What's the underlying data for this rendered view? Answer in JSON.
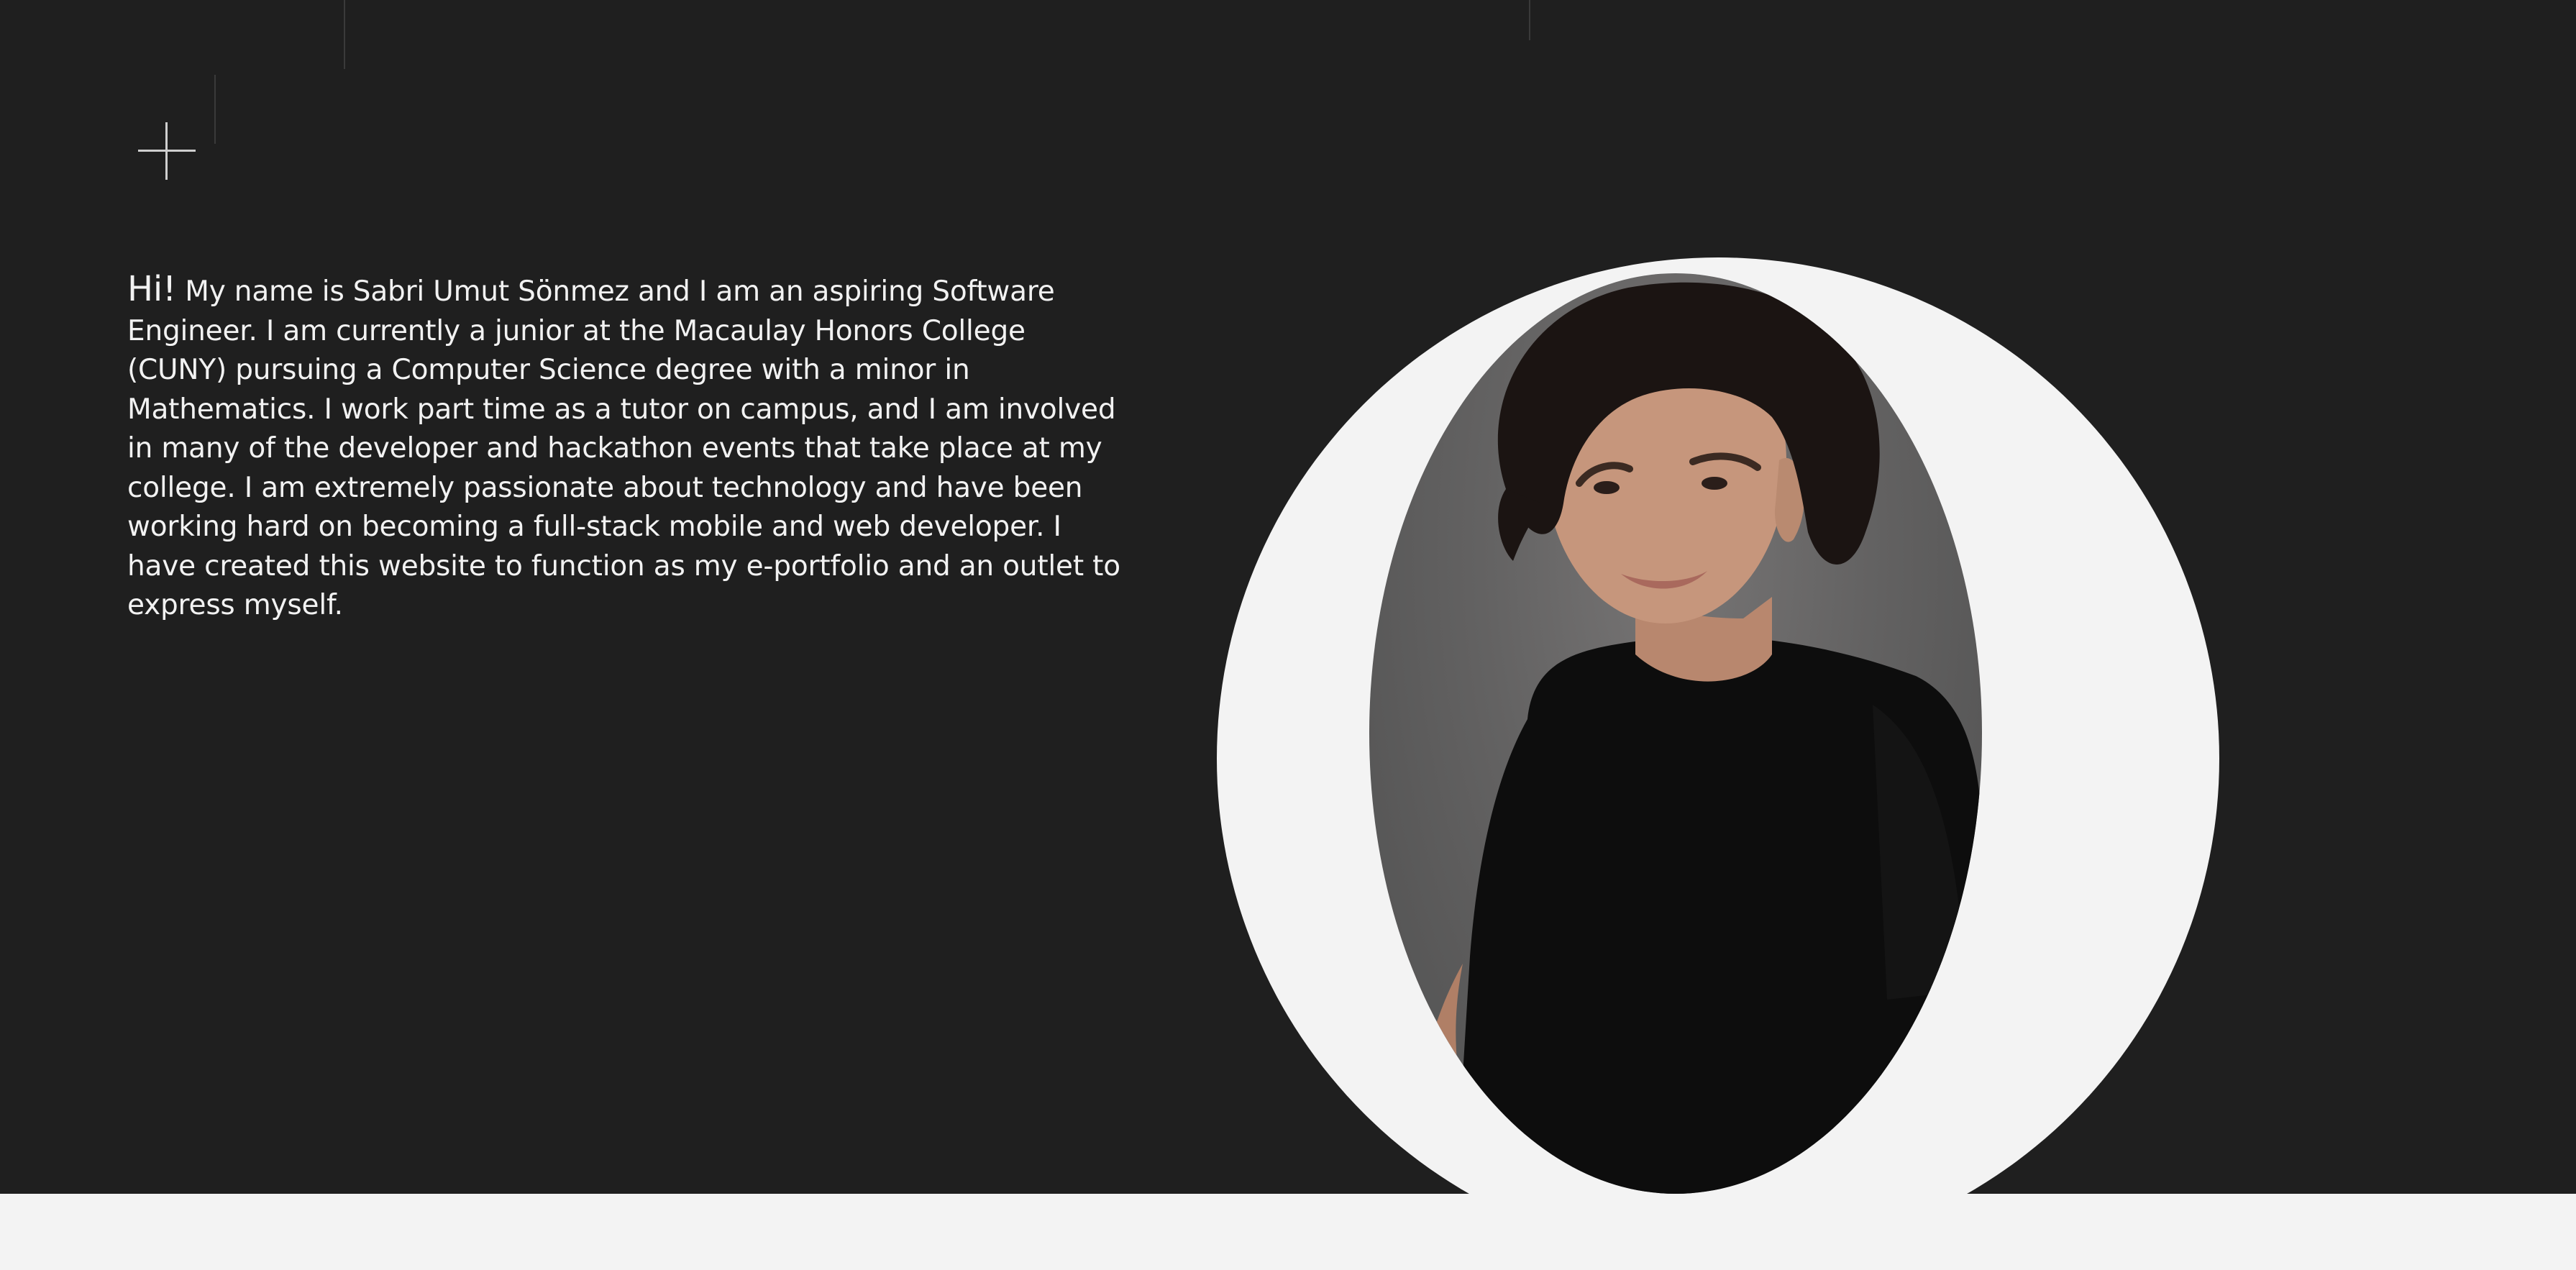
{
  "intro": {
    "greeting": "Hi!",
    "body": "My name is Sabri Umut Sönmez and I am an aspiring Software Engineer. I am currently a junior at the Macaulay Honors College (CUNY) pursuing a Computer Science degree with a minor in Mathematics. I work part time as a tutor on campus, and I am involved in many of the developer and hackathon events that take place at my college. I am extremely passionate about technology and have been working hard on becoming a full-stack mobile and web developer. I have created this website to function as my e-portfolio and an outlet to express myself."
  },
  "menu": {
    "icon": "plus-icon"
  },
  "colors": {
    "background": "#1f1f1f",
    "text": "#f2f2f2",
    "ring": "#f3f3f3",
    "footer": "#f3f3f3"
  }
}
